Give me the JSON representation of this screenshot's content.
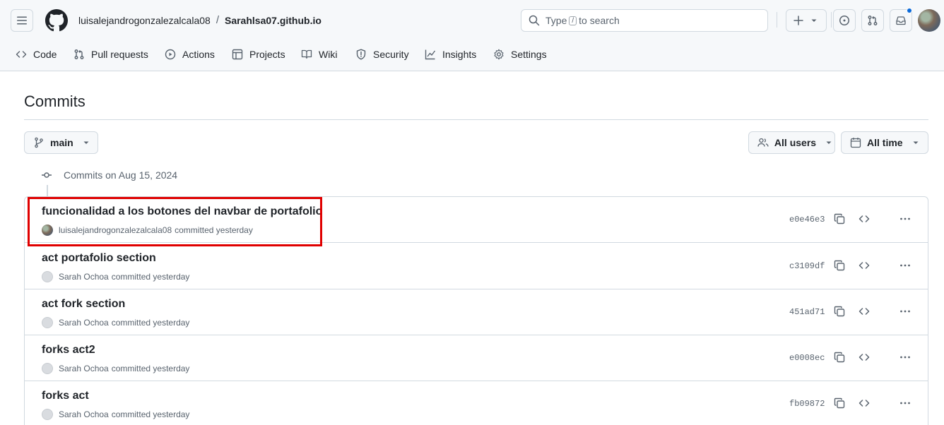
{
  "header": {
    "owner": "luisalejandrogonzalezalcala08",
    "separator": "/",
    "repo": "Sarahlsa07.github.io",
    "search_placeholder_pre": "Type",
    "search_key": "/",
    "search_placeholder_post": "to search"
  },
  "tabs": [
    {
      "label": "Code",
      "icon": "code-icon"
    },
    {
      "label": "Pull requests",
      "icon": "pull-request-icon"
    },
    {
      "label": "Actions",
      "icon": "play-icon"
    },
    {
      "label": "Projects",
      "icon": "table-icon"
    },
    {
      "label": "Wiki",
      "icon": "book-icon"
    },
    {
      "label": "Security",
      "icon": "shield-icon"
    },
    {
      "label": "Insights",
      "icon": "graph-icon"
    },
    {
      "label": "Settings",
      "icon": "gear-icon"
    }
  ],
  "page": {
    "title": "Commits",
    "branch": "main",
    "users_filter": "All users",
    "time_filter": "All time",
    "date_heading": "Commits on Aug 15, 2024"
  },
  "commits": [
    {
      "message": "funcionalidad a los botones del navbar de portafolio",
      "author": "luisalejandrogonzalezalcala08",
      "when": "committed yesterday",
      "sha": "e0e46e3",
      "avatar": "photo"
    },
    {
      "message": "act portafolio section",
      "author": "Sarah Ochoa",
      "when": "committed yesterday",
      "sha": "c3109df",
      "avatar": "ghost"
    },
    {
      "message": "act fork section",
      "author": "Sarah Ochoa",
      "when": "committed yesterday",
      "sha": "451ad71",
      "avatar": "ghost"
    },
    {
      "message": "forks act2",
      "author": "Sarah Ochoa",
      "when": "committed yesterday",
      "sha": "e0008ec",
      "avatar": "ghost"
    },
    {
      "message": "forks act",
      "author": "Sarah Ochoa",
      "when": "committed yesterday",
      "sha": "fb09872",
      "avatar": "ghost"
    }
  ],
  "colors": {
    "highlight": "#e00000",
    "notification_dot": "#0969da"
  }
}
